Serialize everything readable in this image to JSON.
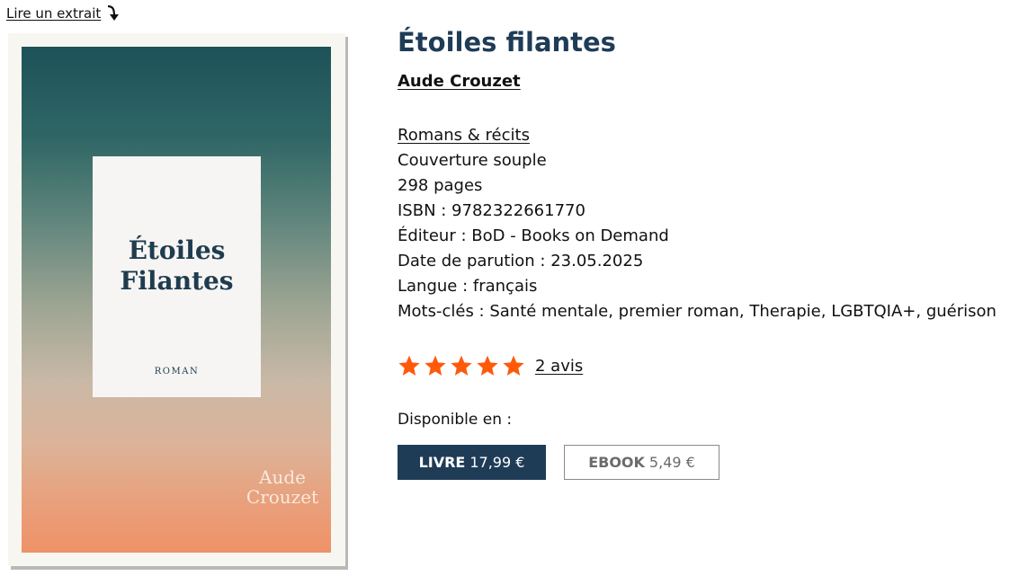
{
  "excerpt": {
    "label": "Lire un extrait",
    "icon": "arrow-down-curved-icon"
  },
  "cover": {
    "title_line1": "Étoiles",
    "title_line2": "Filantes",
    "subtitle": "ROMAN",
    "author_line1": "Aude",
    "author_line2": "Crouzet"
  },
  "book": {
    "title": "Étoiles filantes",
    "author": "Aude Crouzet",
    "category": "Romans & récits",
    "binding": "Couverture souple",
    "pages": "298 pages",
    "isbn": "ISBN : 9782322661770",
    "publisher": "Éditeur : BoD - Books on Demand",
    "release_date": "Date de parution : 23.05.2025",
    "language": "Langue : français",
    "keywords": "Mots-clés : Santé mentale, premier roman, Therapie, LGBTQIA+, guérison"
  },
  "rating": {
    "stars": 5,
    "max": 5,
    "reviews_label": "2 avis",
    "star_color": "#ff5a0a"
  },
  "availability": {
    "label": "Disponible en :",
    "formats": [
      {
        "type": "LIVRE",
        "price": "17,99 €"
      },
      {
        "type": "EBOOK",
        "price": "5,49 €"
      }
    ]
  },
  "colors": {
    "brand": "#1f3c57"
  }
}
